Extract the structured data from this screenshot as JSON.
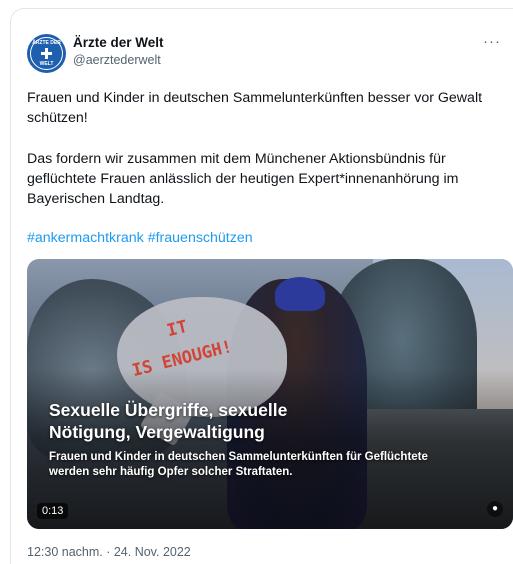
{
  "tweet": {
    "author_name": "Ärzte der Welt",
    "author_handle": "@aerztederwelt",
    "avatar_text_top": "ÄRZTE DER",
    "avatar_text_bottom": "WELT",
    "more_label": "···",
    "paragraph_1": "Frauen und Kinder in deutschen Sammelunterkünften besser vor Gewalt schützen!",
    "paragraph_2": "Das fordern wir zusammen mit dem Münchener Aktionsbündnis für geflüchtete Frauen anlässlich der heutigen Expert*innenanhörung im Bayerischen Landtag.",
    "hashtags": [
      "#ankermachtkrank",
      "#frauenschützen"
    ],
    "timestamp": "12:30 nachm. · 24. Nov. 2022"
  },
  "media": {
    "sign_line_1": "IT",
    "sign_line_2": "IS ENOUGH!",
    "headline": "Sexuelle Übergriffe, sexuelle Nötigung, Vergewaltigung",
    "subline": "Frauen und Kinder in deutschen Sammelunterkünften für Geflüchtete werden sehr häufig Opfer solcher Straftaten.",
    "duration": "0:13"
  },
  "colors": {
    "brand_blue": "#1e5fae",
    "link_blue": "#1d9bf0",
    "secondary_text": "#536471",
    "sign_red": "#d24436"
  }
}
